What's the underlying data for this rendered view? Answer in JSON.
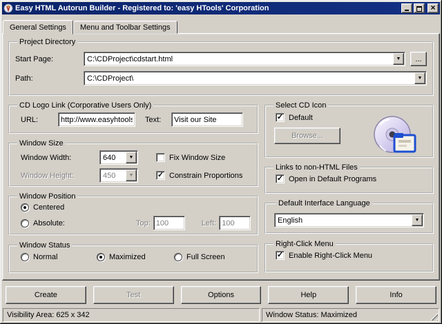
{
  "window": {
    "title": "Easy HTML Autorun Builder - Registered to: 'easy HTools' Corporation"
  },
  "tabs": [
    "General Settings",
    "Menu and Toolbar Settings"
  ],
  "project_directory": {
    "title": "Project Directory",
    "start_page_label": "Start Page:",
    "start_page_value": "C:\\CDProject\\cdstart.html",
    "browse_ellipsis": "...",
    "path_label": "Path:",
    "path_value": "C:\\CDProject\\"
  },
  "cd_logo_link": {
    "title": "CD Logo Link (Corporative Users Only)",
    "url_label": "URL:",
    "url_value": "http://www.easyhtools.com",
    "text_label": "Text:",
    "text_value": "Visit our Site"
  },
  "window_size": {
    "title": "Window Size",
    "width_label": "Window Width:",
    "width_value": "640",
    "height_label": "Window Height:",
    "height_value": "450",
    "fix_label": "Fix Window Size",
    "constrain_label": "Constrain Proportions"
  },
  "window_position": {
    "title": "Window Position",
    "centered_label": "Centered",
    "absolute_label": "Absolute:",
    "top_label": "Top:",
    "top_value": "100",
    "left_label": "Left:",
    "left_value": "100"
  },
  "window_status": {
    "title": "Window Status",
    "options": [
      "Normal",
      "Maximized",
      "Full Screen"
    ]
  },
  "select_cd_icon": {
    "title": "Select CD Icon",
    "default_label": "Default",
    "browse_label": "Browse..."
  },
  "links_non_html": {
    "title": "Links to non-HTML Files",
    "open_label": "Open in Default Programs"
  },
  "language": {
    "title": "Default Interface Language",
    "value": "English"
  },
  "right_click": {
    "title": "Right-Click Menu",
    "enable_label": "Enable Right-Click Menu"
  },
  "actions": {
    "create": "Create",
    "test": "Test",
    "options": "Options",
    "help": "Help",
    "info": "Info"
  },
  "status_bar": {
    "left": "Visibility Area: 625 x 342",
    "right": "Window Status: Maximized"
  },
  "states": {
    "fix_window_size": false,
    "constrain_proportions": true,
    "position_centered": true,
    "position_absolute": false,
    "status_normal": false,
    "status_maximized": true,
    "status_fullscreen": false,
    "cd_icon_default": true,
    "open_in_default_programs": true,
    "enable_right_click_menu": true,
    "height_disabled": true,
    "absolute_fields_disabled": true,
    "browse_disabled": true,
    "test_disabled": true
  },
  "colors": {
    "titlebar": "#0a246a",
    "face": "#d4d0c8",
    "disabled_text": "#808080"
  }
}
